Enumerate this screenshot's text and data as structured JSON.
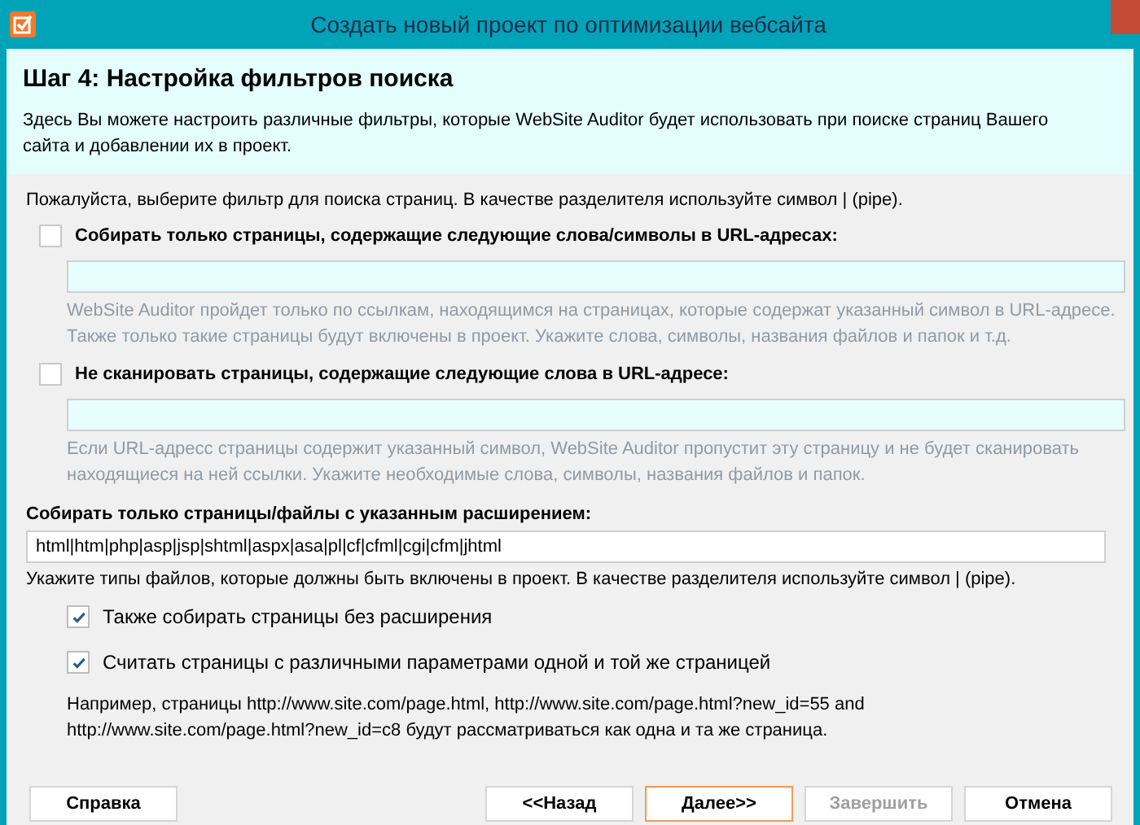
{
  "window": {
    "title": "Создать новый проект по оптимизации вебсайта"
  },
  "header": {
    "title": "Шаг 4: Настройка фильтров поиска",
    "description": "Здесь Вы можете настроить различные фильтры, которые WebSite Auditor будет использовать при поиске страниц Вашего сайта и добавлении их в проект."
  },
  "intro": "Пожалуйста, выберите фильтр для поиска страниц. В качестве разделителя используйте символ | (pipe).",
  "filters": [
    {
      "label": "Собирать только страницы, содержащие следующие слова/символы в URL-адресах:",
      "checked": false,
      "hint": "WebSite Auditor пройдет только по ссылкам, находящимся на страницах, которые содержат указанный символ в URL-адресе. Также только такие страницы будут включены в проект. Укажите слова, символы, названия файлов и папок и т.д."
    },
    {
      "label": "Не сканировать страницы, содержащие следующие слова в URL-адресе:",
      "checked": false,
      "hint": "Если URL-адресс страницы содержит указанный символ, WebSite Auditor пропустит эту страницу и не будет сканировать находящиеся на ней ссылки. Укажите необходимые слова, символы, названия файлов и папок."
    }
  ],
  "extensions": {
    "label": "Собирать только страницы/файлы с указанным расширением:",
    "value": "html|htm|php|asp|jsp|shtml|aspx|asa|pl|cf|cfml|cgi|cfm|jhtml",
    "hint": "Укажите типы файлов, которые должны быть включены в проект. В качестве разделителя используйте символ | (pipe)."
  },
  "options": [
    {
      "label": "Также собирать страницы без расширения",
      "checked": true
    },
    {
      "label": "Считать страницы с различными параметрами одной и той же страницей",
      "checked": true,
      "note": "Например, страницы http://www.site.com/page.html, http://www.site.com/page.html?new_id=55 and http://www.site.com/page.html?new_id=c8 будут рассматриваться как одна и та же страница."
    }
  ],
  "buttons": [
    {
      "label": "Справка",
      "kind": "left",
      "focused": false,
      "disabled": false
    },
    {
      "label": "<<Назад",
      "kind": "right",
      "focused": false,
      "disabled": false
    },
    {
      "label": "Далее>>",
      "kind": "right",
      "focused": true,
      "disabled": false
    },
    {
      "label": "Завершить",
      "kind": "right",
      "focused": false,
      "disabled": true
    },
    {
      "label": "Отмена",
      "kind": "right",
      "focused": false,
      "disabled": false
    }
  ]
}
